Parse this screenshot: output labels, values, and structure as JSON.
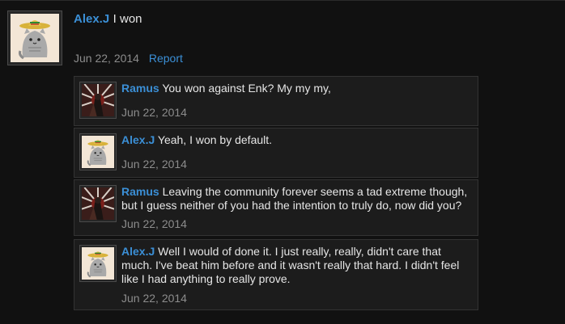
{
  "post": {
    "author": "Alex.J",
    "text": "I won",
    "date": "Jun 22, 2014",
    "report_label": "Report"
  },
  "comments": [
    {
      "author": "Ramus",
      "text": "You won against Enk? My my my,",
      "date": "Jun 22, 2014",
      "avatar": "ramus-avatar"
    },
    {
      "author": "Alex.J",
      "text": "Yeah, I won by default.",
      "date": "Jun 22, 2014",
      "avatar": "pusheen-sombrero-avatar"
    },
    {
      "author": "Ramus",
      "text": "Leaving the community forever seems a tad extreme though, but I guess neither of you had the intention to truly do, now did you?",
      "date": "Jun 22, 2014",
      "avatar": "ramus-avatar"
    },
    {
      "author": "Alex.J",
      "text": "Well I would of done it. I just really, really, didn't care that much. I've beat him before and it wasn't really that hard. I didn't feel like I had anything to really prove.",
      "date": "Jun 22, 2014",
      "avatar": "pusheen-sombrero-avatar"
    }
  ],
  "colors": {
    "username": "#3b8fd6",
    "background": "#111111",
    "comment_background": "#1c1c1c",
    "date": "#8c8c8c"
  }
}
